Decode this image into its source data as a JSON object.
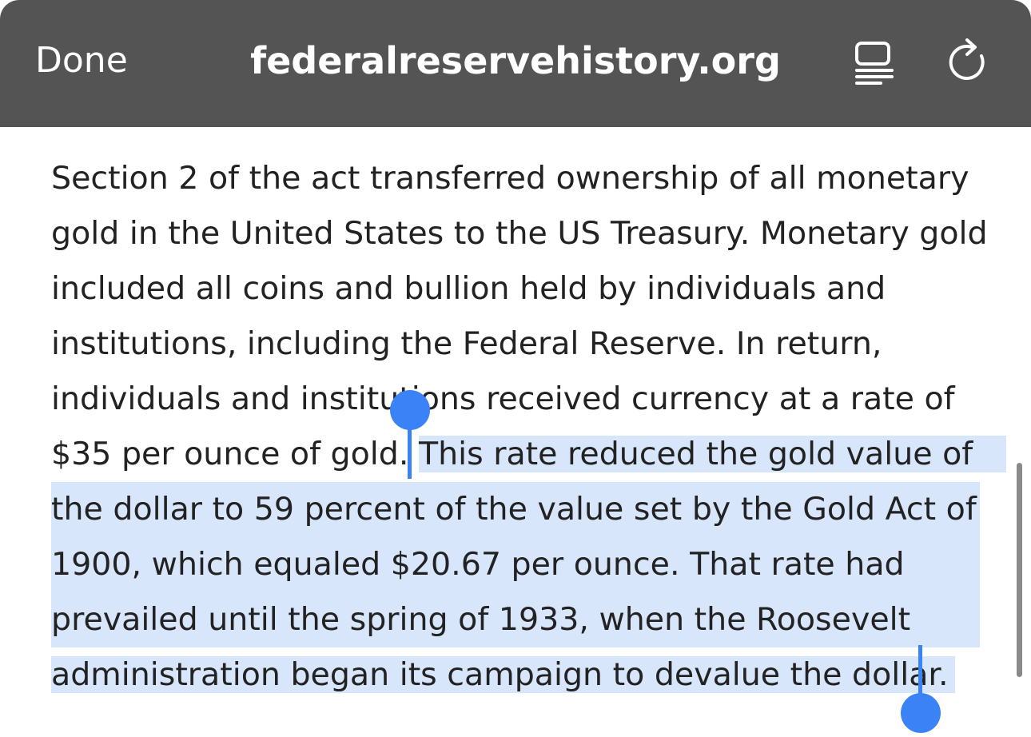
{
  "toolbar": {
    "done_label": "Done",
    "site_title": "federalreservehistory.org",
    "reader_icon": "reader-mode-icon",
    "reload_icon": "reload-icon"
  },
  "article": {
    "lines": [
      "Section 2 of the act transferred ownership of all monetary",
      "gold in the United States to the US Treasury. Monetary gold",
      "included all coins and bullion held by individuals and",
      "institutions, including the Federal Reserve. In return,",
      "individuals and institutions received currency at a rate of",
      "$35 per ounce of gold. "
    ],
    "selected_lines": [
      "This rate reduced the gold value of",
      "the dollar to 59 percent of the value set by the Gold Act of",
      "1900, which equaled $20.67 per ounce. That rate had",
      "prevailed until the spring of 1933, when the Roosevelt",
      "administration began its campaign to devalue the dollar."
    ]
  },
  "colors": {
    "toolbar_bg": "#545454",
    "selection_bg": "#d8e6fc",
    "handle": "#3b82f6"
  }
}
